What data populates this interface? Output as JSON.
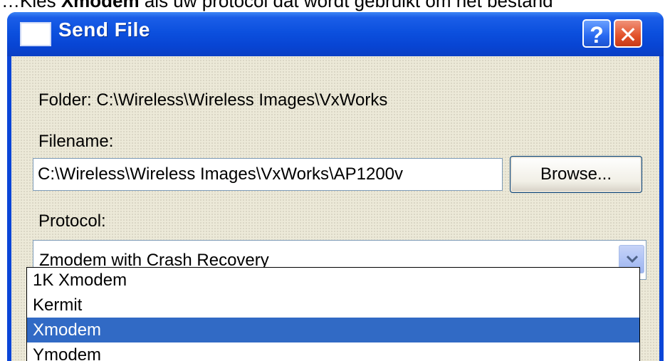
{
  "caption": {
    "before": "…Kies ",
    "bold": "Xmodem",
    "after": " als uw protocol dat wordt gebruikt om het bestand"
  },
  "window": {
    "title": "Send File",
    "help_glyph": "?",
    "close_glyph": "✕"
  },
  "form": {
    "folder_label": "Folder:  C:\\Wireless\\Wireless Images\\VxWorks",
    "filename_label": "Filename:",
    "filename_value": "C:\\Wireless\\Wireless Images\\VxWorks\\AP1200v",
    "browse_label": "Browse...",
    "protocol_label": "Protocol:",
    "protocol_selected": "Zmodem with Crash Recovery",
    "protocol_options": [
      "1K Xmodem",
      "Kermit",
      "Xmodem",
      "Ymodem"
    ],
    "highlighted_option": "Xmodem"
  },
  "colors": {
    "titlebar": "#0a45d8",
    "highlight": "#316ac5",
    "dialog_bg": "#ece9d8"
  }
}
